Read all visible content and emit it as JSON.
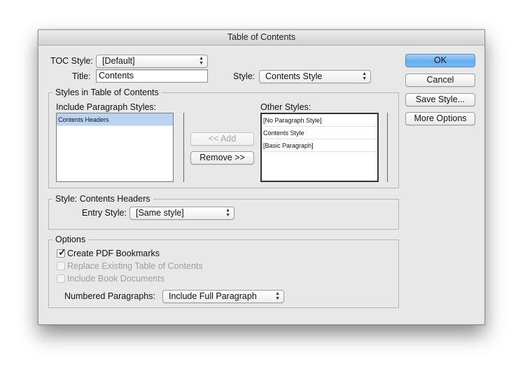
{
  "dialog": {
    "title": "Table of Contents"
  },
  "toc": {
    "style_label": "TOC Style:",
    "style_value": "[Default]",
    "title_label": "Title:",
    "title_value": "Contents",
    "title_style_label": "Style:",
    "title_style_value": "Contents Style"
  },
  "buttons": {
    "ok": "OK",
    "cancel": "Cancel",
    "save_style": "Save Style...",
    "more_options": "More Options",
    "add": "<< Add",
    "remove": "Remove >>"
  },
  "styles_group": {
    "title": "Styles in Table of Contents",
    "include_label": "Include Paragraph Styles:",
    "include_items": [
      "Contents Headers"
    ],
    "other_label": "Other Styles:",
    "other_items": [
      "[No Paragraph Style]",
      "Contents Style",
      "[Basic Paragraph]"
    ]
  },
  "style_group": {
    "title": "Style: Contents Headers",
    "entry_label": "Entry Style:",
    "entry_value": "[Same style]"
  },
  "options_group": {
    "title": "Options",
    "create_pdf_bookmarks": "Create PDF Bookmarks",
    "create_pdf_bookmarks_checked": true,
    "replace_existing": "Replace Existing Table of Contents",
    "include_book": "Include Book Documents",
    "numbered_label": "Numbered Paragraphs:",
    "numbered_value": "Include Full Paragraph"
  },
  "colors": {
    "default_button": "#63aef0",
    "selection": "#b8d4f1"
  }
}
